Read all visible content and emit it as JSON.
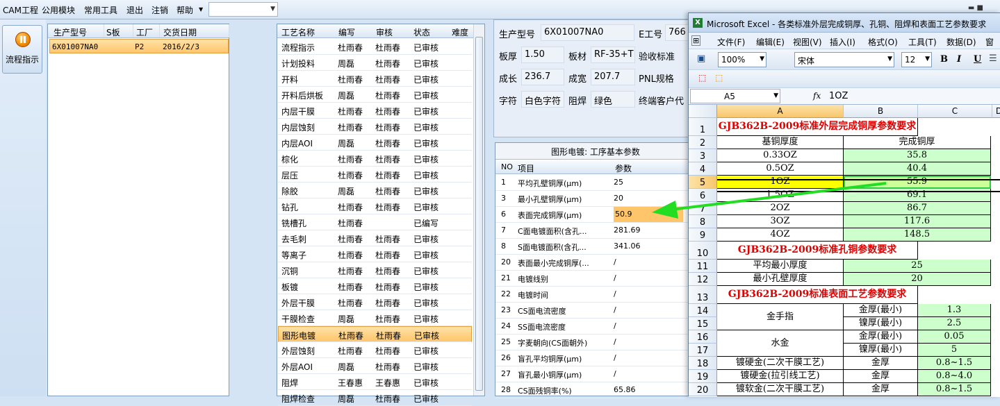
{
  "menubar": {
    "items": [
      "CAM工程",
      "公用模块",
      "常用工具",
      "退出",
      "注销",
      "帮助"
    ],
    "dropdown_arrow": "▼",
    "combo_value": "",
    "window_controls": "▬ ■"
  },
  "leftbar": {
    "flow_button_label": "流程指示",
    "flow_icon": "pause-icon"
  },
  "orders": {
    "columns": [
      "生产型号",
      "S板",
      "工厂",
      "交货日期"
    ],
    "rows": [
      {
        "model": "6X01007NA0",
        "sboard": "",
        "factory": "P2",
        "date": "2016/2/3"
      }
    ]
  },
  "process": {
    "columns": [
      "工艺名称",
      "编写",
      "审核",
      "状态",
      "难度"
    ],
    "rows": [
      {
        "name": "流程指示",
        "writer": "杜雨春",
        "reviewer": "杜雨春",
        "status": "已审核"
      },
      {
        "name": "计划投料",
        "writer": "周磊",
        "reviewer": "杜雨春",
        "status": "已审核"
      },
      {
        "name": "开料",
        "writer": "杜雨春",
        "reviewer": "杜雨春",
        "status": "已审核"
      },
      {
        "name": "开料后烘板",
        "writer": "周磊",
        "reviewer": "杜雨春",
        "status": "已审核"
      },
      {
        "name": "内层干膜",
        "writer": "杜雨春",
        "reviewer": "杜雨春",
        "status": "已审核"
      },
      {
        "name": "内层蚀刻",
        "writer": "杜雨春",
        "reviewer": "杜雨春",
        "status": "已审核"
      },
      {
        "name": "内层AOI",
        "writer": "周磊",
        "reviewer": "杜雨春",
        "status": "已审核"
      },
      {
        "name": "棕化",
        "writer": "杜雨春",
        "reviewer": "杜雨春",
        "status": "已审核"
      },
      {
        "name": "层压",
        "writer": "杜雨春",
        "reviewer": "杜雨春",
        "status": "已审核"
      },
      {
        "name": "除胶",
        "writer": "周磊",
        "reviewer": "杜雨春",
        "status": "已审核"
      },
      {
        "name": "钻孔",
        "writer": "杜雨春",
        "reviewer": "杜雨春",
        "status": "已审核"
      },
      {
        "name": "铣槽孔",
        "writer": "杜雨春",
        "reviewer": "",
        "status": "已编写"
      },
      {
        "name": "去毛刺",
        "writer": "杜雨春",
        "reviewer": "杜雨春",
        "status": "已审核"
      },
      {
        "name": "等离子",
        "writer": "杜雨春",
        "reviewer": "杜雨春",
        "status": "已审核"
      },
      {
        "name": "沉铜",
        "writer": "杜雨春",
        "reviewer": "杜雨春",
        "status": "已审核"
      },
      {
        "name": "板镀",
        "writer": "杜雨春",
        "reviewer": "杜雨春",
        "status": "已审核"
      },
      {
        "name": "外层干膜",
        "writer": "杜雨春",
        "reviewer": "杜雨春",
        "status": "已审核"
      },
      {
        "name": "干膜检查",
        "writer": "周磊",
        "reviewer": "杜雨春",
        "status": "已审核"
      },
      {
        "name": "图形电镀",
        "writer": "杜雨春",
        "reviewer": "杜雨春",
        "status": "已审核"
      },
      {
        "name": "外层蚀刻",
        "writer": "杜雨春",
        "reviewer": "杜雨春",
        "status": "已审核"
      },
      {
        "name": "外层AOI",
        "writer": "周磊",
        "reviewer": "杜雨春",
        "status": "已审核"
      },
      {
        "name": "阻焊",
        "writer": "王春惠",
        "reviewer": "王春惠",
        "status": "已审核"
      },
      {
        "name": "阻焊检查",
        "writer": "周磊",
        "reviewer": "杜雨春",
        "status": "已审核"
      }
    ]
  },
  "info": {
    "model_label": "生产型号",
    "model_value": "6X01007NA0",
    "eno_label": "E工号",
    "eno_value": "766",
    "thick_label": "板厚",
    "thick_value": "1.50",
    "material_label": "板材",
    "material_value": "RF-35+T",
    "accept_label": "验收标准",
    "len_label": "成长",
    "len_value": "236.7",
    "wid_label": "成宽",
    "wid_value": "207.7",
    "pnl_label": "PNL规格",
    "char_label": "字符",
    "char_value": "白色字符",
    "mask_label": "阻焊",
    "mask_value": "绿色",
    "client_label": "终端客户代"
  },
  "params": {
    "title": "图形电镀: 工序基本参数",
    "columns": [
      "NO",
      "项目",
      "参数"
    ],
    "rows": [
      {
        "no": "1",
        "item": "平均孔壁铜厚(μm)",
        "value": "25"
      },
      {
        "no": "3",
        "item": "最小孔壁铜厚(μm)",
        "value": "20"
      },
      {
        "no": "6",
        "item": "表面完成铜厚(μm)",
        "value": "50.9"
      },
      {
        "no": "7",
        "item": "C面电镀面积(含孔...",
        "value": "281.69"
      },
      {
        "no": "8",
        "item": "S面电镀面积(含孔...",
        "value": "341.06"
      },
      {
        "no": "20",
        "item": "表面最小完成铜厚(...",
        "value": "/"
      },
      {
        "no": "21",
        "item": "电镀线别",
        "value": "/"
      },
      {
        "no": "22",
        "item": "电镀时间",
        "value": "/"
      },
      {
        "no": "23",
        "item": "CS面电流密度",
        "value": "/"
      },
      {
        "no": "24",
        "item": "SS面电流密度",
        "value": "/"
      },
      {
        "no": "25",
        "item": "字麦朝向(CS面朝外)",
        "value": "/"
      },
      {
        "no": "26",
        "item": "盲孔平均铜厚(μm)",
        "value": "/"
      },
      {
        "no": "27",
        "item": "盲孔最小铜厚(μm)",
        "value": "/"
      },
      {
        "no": "28",
        "item": "CS面残铜率(%)",
        "value": "65.86"
      }
    ]
  },
  "excel": {
    "title": "Microsoft Excel - 各类标准外层完成铜厚、孔铜、阻焊和表面工艺参数要求",
    "menu": [
      "文件(F)",
      "编辑(E)",
      "视图(V)",
      "插入(I)",
      "格式(O)",
      "工具(T)",
      "数据(D)",
      "窗口"
    ],
    "zoom": "100%",
    "font_name": "宋体",
    "font_size": "12",
    "bold": "B",
    "italic": "I",
    "underline": "U",
    "name_box": "A5",
    "fx": "fx",
    "formula": "1OZ",
    "col_headers": [
      "A",
      "B",
      "C",
      "D"
    ],
    "rows": [
      {
        "n": "1",
        "title": "GJB362B-2009标准外层完成铜厚参数要求"
      },
      {
        "n": "2",
        "a": "基铜厚度",
        "b": "完成铜厚"
      },
      {
        "n": "3",
        "a": "0.33OZ",
        "b": "35.8"
      },
      {
        "n": "4",
        "a": "0.5OZ",
        "b": "40.4"
      },
      {
        "n": "5",
        "a": "1OZ",
        "b": "55.9"
      },
      {
        "n": "6",
        "a": "1.5OZ",
        "b": "69.1"
      },
      {
        "n": "7",
        "a": "2OZ",
        "b": "86.7"
      },
      {
        "n": "8",
        "a": "3OZ",
        "b": "117.6"
      },
      {
        "n": "9",
        "a": "4OZ",
        "b": "148.5"
      },
      {
        "n": "10",
        "title": "GJB362B-2009标准孔铜参数要求"
      },
      {
        "n": "11",
        "a": "平均最小厚度",
        "b": "25"
      },
      {
        "n": "12",
        "a": "最小孔壁厚度",
        "b": "20"
      },
      {
        "n": "13",
        "title": "GJB362B-2009标准表面工艺参数要求"
      },
      {
        "n": "14",
        "a": "金手指",
        "b": "金厚(最小)",
        "c": "1.3"
      },
      {
        "n": "15",
        "b": "镍厚(最小)",
        "c": "2.5"
      },
      {
        "n": "16",
        "a": "水金",
        "b": "金厚(最小)",
        "c": "0.05"
      },
      {
        "n": "17",
        "b": "镍厚(最小)",
        "c": "5"
      },
      {
        "n": "18",
        "a": "镀硬金(二次干膜工艺)",
        "b": "金厚",
        "c": "0.8~1.5"
      },
      {
        "n": "19",
        "a": "镀硬金(拉引线工艺)",
        "b": "金厚",
        "c": "0.8~4.0"
      },
      {
        "n": "20",
        "a": "镀软金(二次干膜工艺)",
        "b": "金厚",
        "c": "0.8~1.5"
      }
    ]
  },
  "colors": {
    "accent_selection": "#ffc56a",
    "arrow": "#22dd22",
    "sheet_title": "#e00000",
    "green_cell": "#ccffcc"
  }
}
